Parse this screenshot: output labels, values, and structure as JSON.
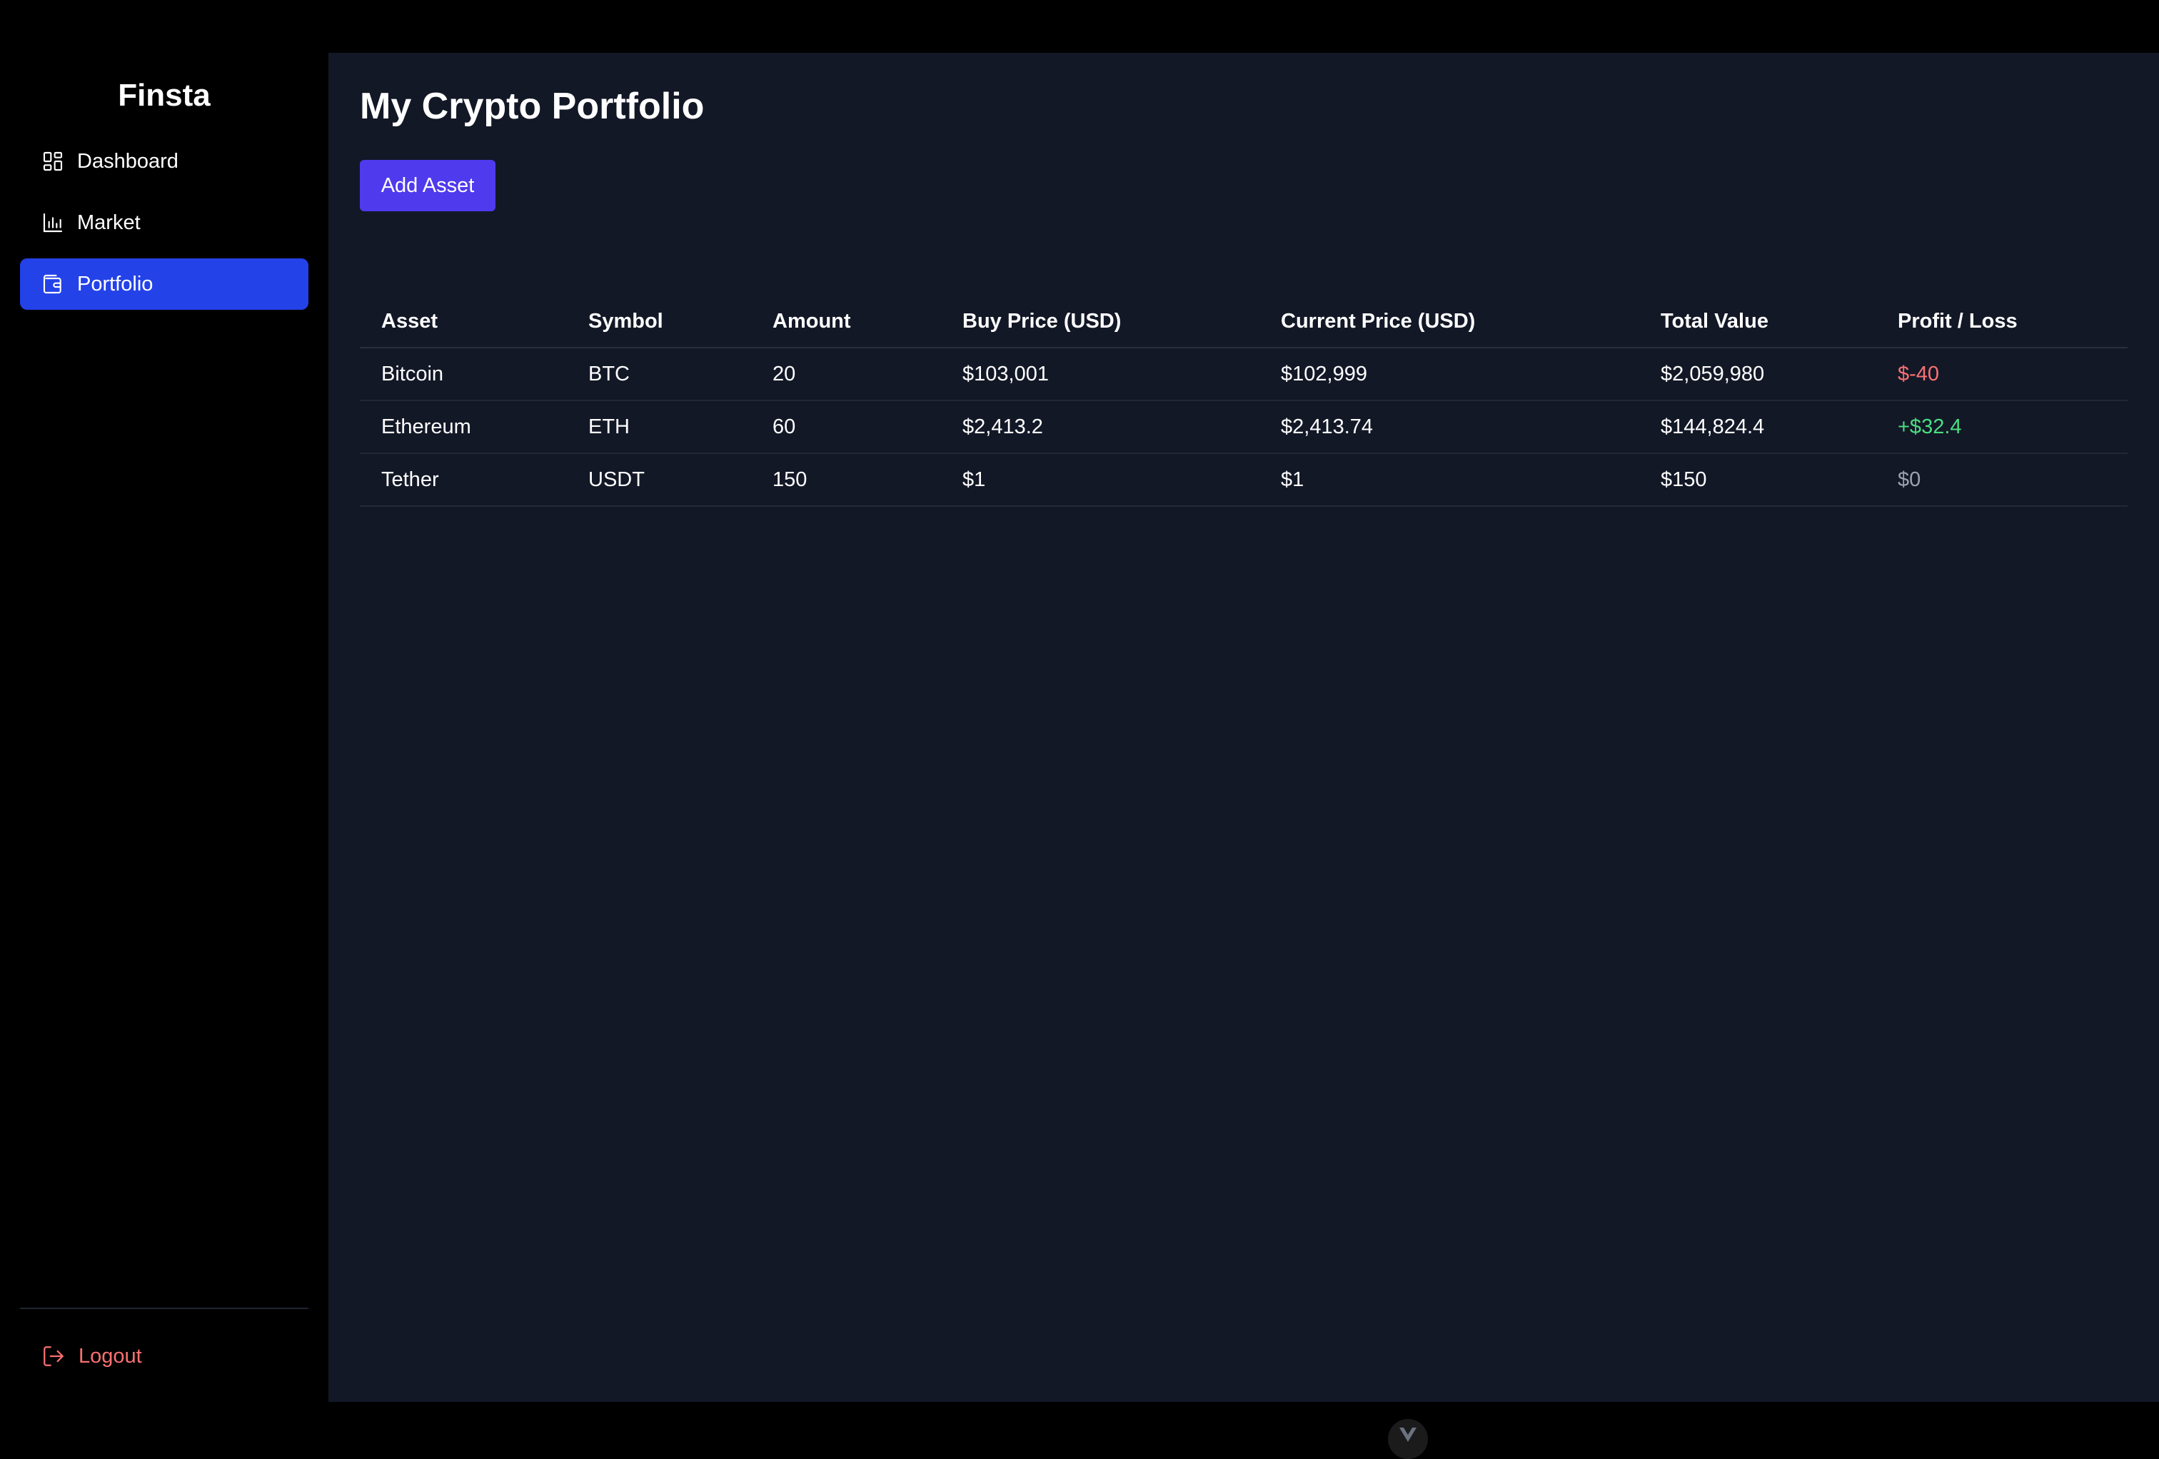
{
  "app": {
    "brand": "Finsta"
  },
  "sidebar": {
    "items": [
      {
        "label": "Dashboard",
        "icon": "dashboard-grid-icon",
        "active": false
      },
      {
        "label": "Market",
        "icon": "bar-chart-icon",
        "active": false
      },
      {
        "label": "Portfolio",
        "icon": "wallet-icon",
        "active": true
      }
    ],
    "logout_label": "Logout",
    "logout_icon": "logout-icon"
  },
  "main": {
    "title": "My Crypto Portfolio",
    "add_button_label": "Add Asset"
  },
  "table": {
    "headers": [
      "Asset",
      "Symbol",
      "Amount",
      "Buy Price (USD)",
      "Current Price (USD)",
      "Total Value",
      "Profit / Loss"
    ],
    "rows": [
      {
        "asset": "Bitcoin",
        "symbol": "BTC",
        "amount": "20",
        "buy_price": "$103,001",
        "current_price": "$102,999",
        "total_value": "$2,059,980",
        "profit_loss": "$-40",
        "pl_status": "negative"
      },
      {
        "asset": "Ethereum",
        "symbol": "ETH",
        "amount": "60",
        "buy_price": "$2,413.2",
        "current_price": "$2,413.74",
        "total_value": "$144,824.4",
        "profit_loss": "+$32.4",
        "pl_status": "positive"
      },
      {
        "asset": "Tether",
        "symbol": "USDT",
        "amount": "150",
        "buy_price": "$1",
        "current_price": "$1",
        "total_value": "$150",
        "profit_loss": "$0",
        "pl_status": "neutral"
      }
    ]
  },
  "colors": {
    "sidebar_bg": "#000000",
    "main_bg": "#131827",
    "active_nav": "#2342e8",
    "add_button": "#4f3aee",
    "loss": "#f87171",
    "profit": "#4ade80",
    "neutral": "#9ca3af"
  },
  "devtools_toggle_icon": "vue-logo-icon"
}
